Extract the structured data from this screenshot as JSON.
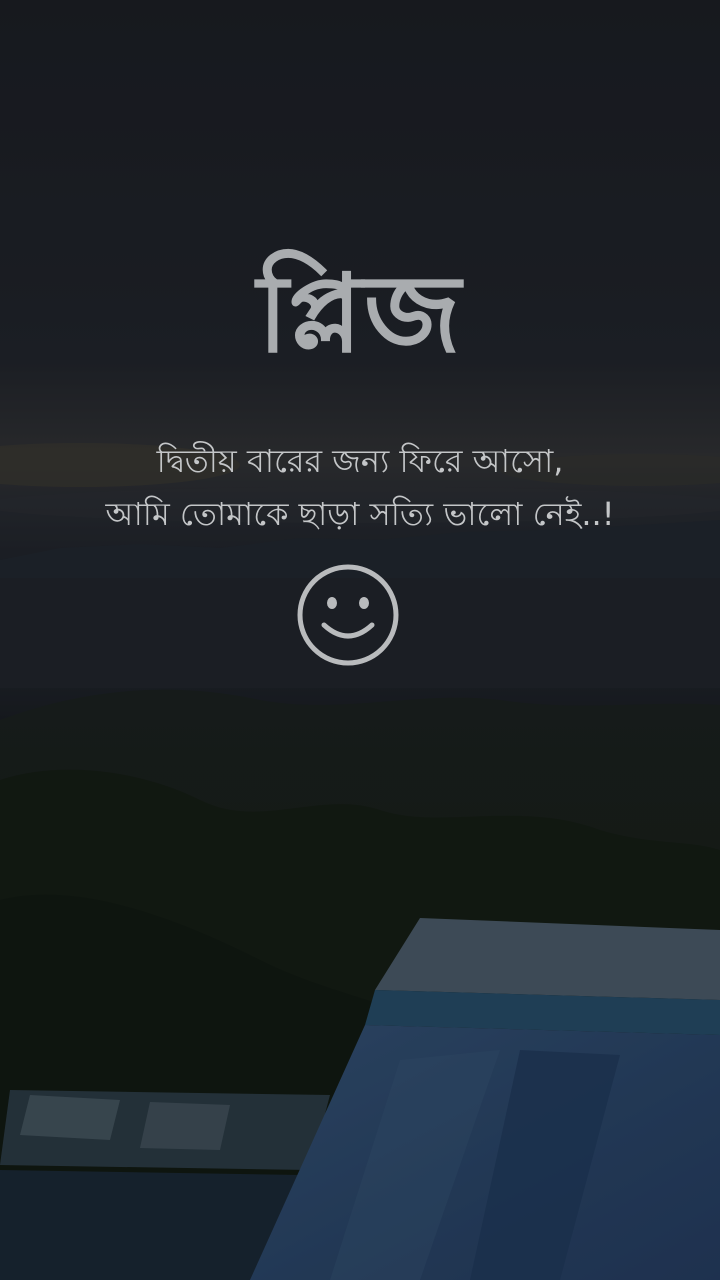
{
  "title": "প্লিজ",
  "lines": [
    "দ্বিতীয় বারের জন্য ফিরে আসো,",
    "আমি তোমাকে ছাড়া সত্যি ভালো নেই..!"
  ],
  "icon": "smiley-face-icon",
  "colors": {
    "text": "#c4c6c8",
    "title": "#a9acaf",
    "sky": "#1e2127",
    "sea": "#2a2f36",
    "forest": "#1c2418",
    "roof": "#3a5f86"
  }
}
